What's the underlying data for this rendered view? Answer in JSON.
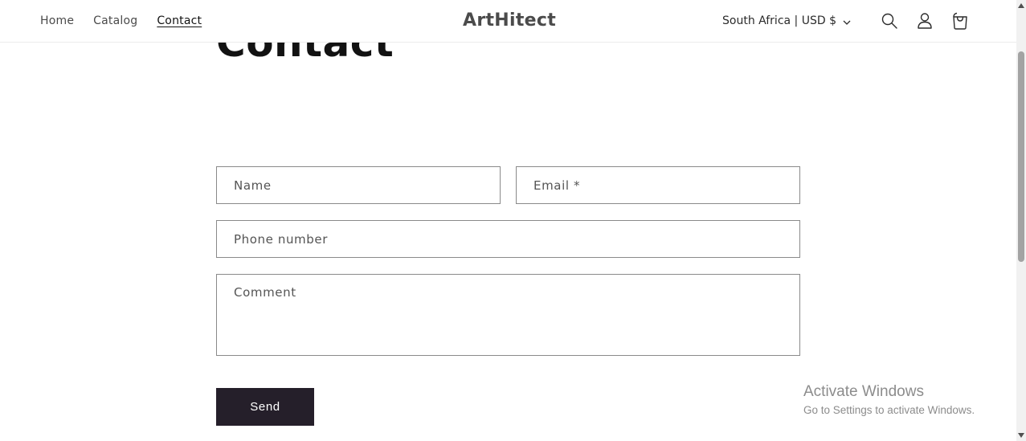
{
  "header": {
    "nav": [
      {
        "label": "Home"
      },
      {
        "label": "Catalog"
      },
      {
        "label": "Contact"
      }
    ],
    "logo": "ArtHitect",
    "localization": "South Africa | USD $",
    "icons": [
      "search-icon",
      "account-icon",
      "cart-icon"
    ]
  },
  "main": {
    "title": "Contact",
    "form": {
      "name_placeholder": "Name",
      "email_placeholder": "Email *",
      "phone_placeholder": "Phone number",
      "comment_placeholder": "Comment",
      "send_label": "Send"
    }
  },
  "watermark": {
    "title": "Activate Windows",
    "subtitle": "Go to Settings to activate Windows."
  },
  "colors": {
    "button_bg": "#251f2a",
    "logo": "#4b4b4b",
    "border": "#8a8a8a"
  }
}
